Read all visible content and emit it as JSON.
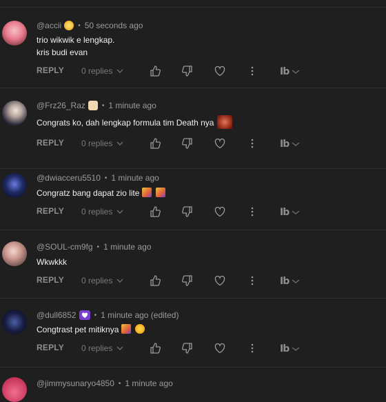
{
  "labels": {
    "reply": "REPLY",
    "replies": "0 replies",
    "dot": "•"
  },
  "comments": [
    {
      "handle": "@accii",
      "time": "50 seconds ago",
      "lines": [
        "trio wikwik e lengkap.",
        "kris budi evan"
      ]
    },
    {
      "handle": "@Frz26_Raz",
      "time": "1 minute ago",
      "lines": [
        "Congrats ko, dah lengkap formula tim Death nya"
      ]
    },
    {
      "handle": "@dwiacceru5510",
      "time": "1 minute ago",
      "lines": [
        "Congratz bang dapat zio lite"
      ]
    },
    {
      "handle": "@SOUL-cm9fg",
      "time": "1 minute ago",
      "lines": [
        "Wkwkkk"
      ]
    },
    {
      "handle": "@dull6852",
      "time": "1 minute ago (edited)",
      "lines": [
        "Congtrast pet mitiknya"
      ]
    }
  ],
  "partial_comment": {
    "handle": "@jimmysunaryo4850",
    "time": "1 minute ago"
  },
  "icons": [
    "like-icon",
    "dislike-icon",
    "heart-icon",
    "more-vert-icon",
    "ib-logo-icon",
    "chevron-down-icon"
  ],
  "colors": {
    "background": "#1f1f1f",
    "text": "#f0f0f0",
    "muted": "#9b9b9b",
    "divider": "#303030",
    "badge": "#7b3fd1"
  }
}
